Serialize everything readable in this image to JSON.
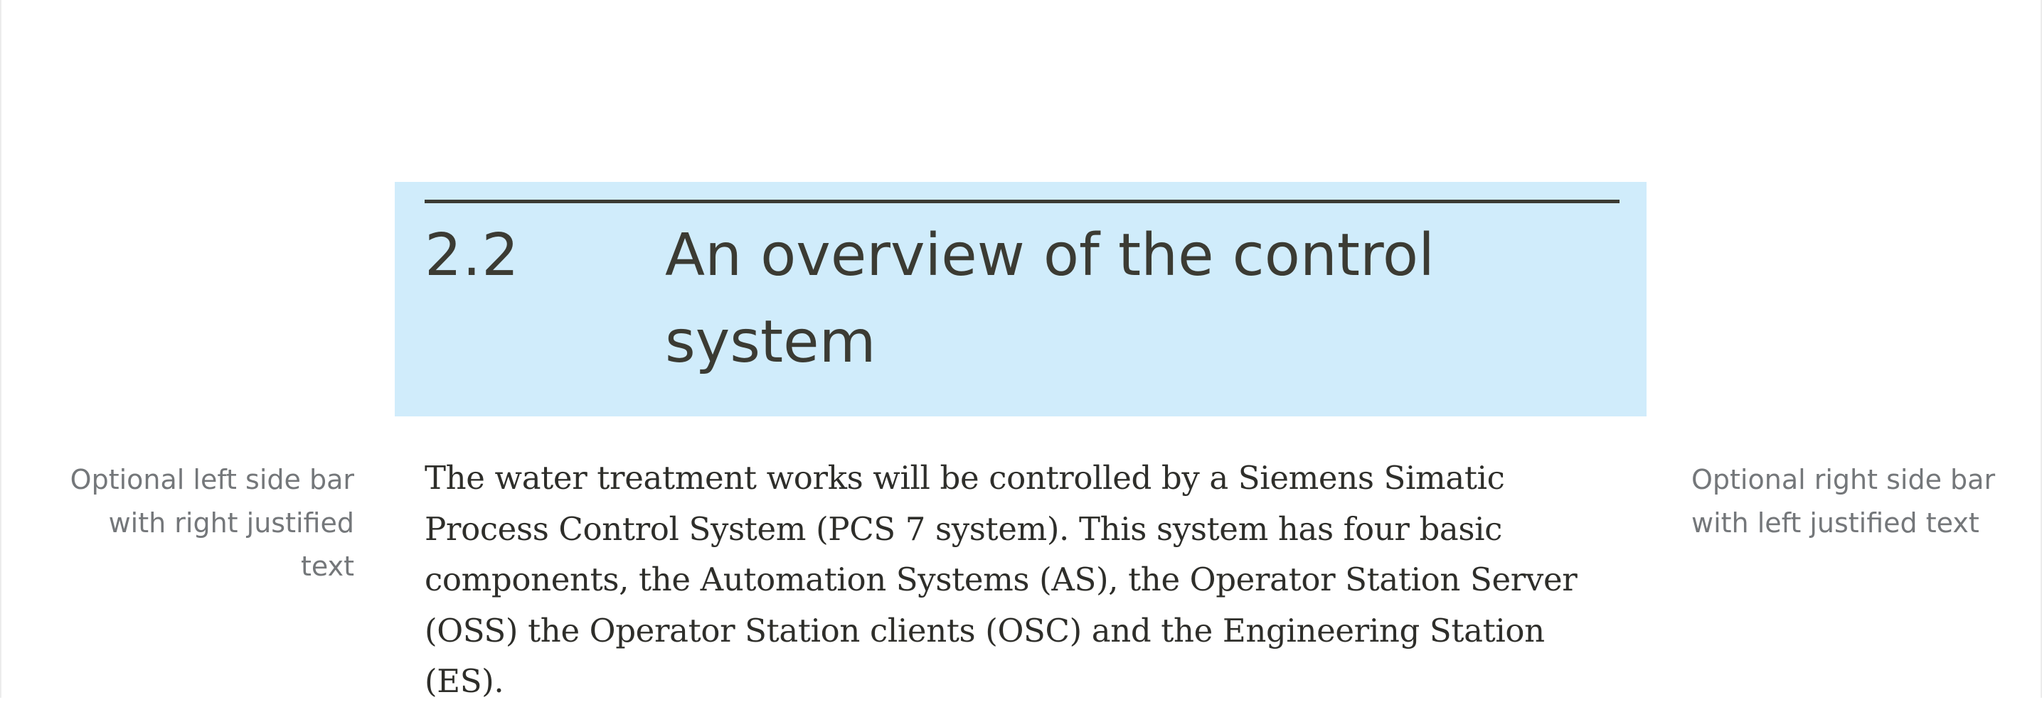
{
  "section": {
    "number": "2.2",
    "title": "An overview of the control system"
  },
  "body": {
    "paragraph": "The water treatment works will be controlled by a Siemens Simatic Process Control System (PCS 7 system). This system has four basic components, the Automation Systems (AS), the Operator Station Server (OSS) the Operator Station clients (OSC) and the Engineering Station (ES)."
  },
  "sidebars": {
    "left": "Optional left side bar with right justified text",
    "right": "Optional right side bar with left justified text"
  },
  "colors": {
    "header_background": "#d0ecfb",
    "heading_text": "#3b3b33",
    "body_text": "#2e2e2a",
    "sidebar_text": "#74777a"
  }
}
